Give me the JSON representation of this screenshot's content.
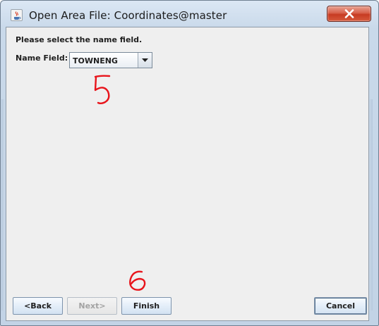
{
  "window": {
    "title": "Open Area File: Coordinates@master",
    "app_icon": "java-coffee-icon",
    "close_icon": "close-icon",
    "close_button_color": "#d0503a"
  },
  "content": {
    "prompt": "Please select the name field.",
    "name_field": {
      "label": "Name Field:",
      "selected_value": "TOWNENG",
      "dropdown_icon": "chevron-down-icon"
    }
  },
  "annotations": {
    "step_5_label": "5",
    "step_6_label": "6",
    "color": "#e8141b"
  },
  "buttons": {
    "back": {
      "label": "<Back",
      "enabled": true
    },
    "next": {
      "label": "Next>",
      "enabled": false
    },
    "finish": {
      "label": "Finish",
      "enabled": true
    },
    "cancel": {
      "label": "Cancel",
      "enabled": true
    }
  }
}
